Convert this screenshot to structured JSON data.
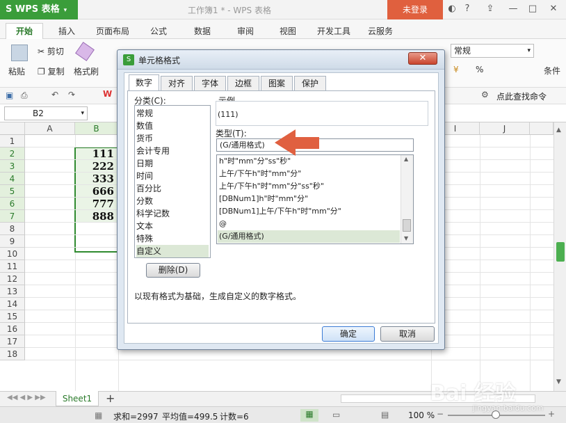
{
  "titlebar": {
    "app_name": "WPS 表格",
    "doc_title": "工作簿1 * - WPS 表格",
    "login": "未登录"
  },
  "ribbon_tabs": [
    "开始",
    "插入",
    "页面布局",
    "公式",
    "数据",
    "审阅",
    "视图",
    "开发工具",
    "云服务"
  ],
  "ribbon": {
    "paste": "粘贴",
    "cut": "剪切",
    "copy": "复制",
    "format_painter": "格式刷",
    "number_format": "常规",
    "percent": "%",
    "conditions": "条件",
    "find_command": "点此查找命令"
  },
  "formula_bar": {
    "cell_ref": "B2"
  },
  "grid": {
    "columns": [
      "A",
      "B",
      "I",
      "J"
    ],
    "rows": [
      "1",
      "2",
      "3",
      "4",
      "5",
      "6",
      "7",
      "8",
      "9",
      "10",
      "11",
      "12",
      "13",
      "14",
      "15",
      "16",
      "17",
      "18"
    ],
    "b_values": [
      "111",
      "222",
      "333",
      "666",
      "777",
      "888"
    ]
  },
  "sheet_tab": "Sheet1",
  "status": {
    "sum": "求和=2997",
    "avg": "平均值=499.5",
    "count": "计数=6",
    "zoom": "100 %"
  },
  "dialog": {
    "title": "单元格格式",
    "tabs": [
      "数字",
      "对齐",
      "字体",
      "边框",
      "图案",
      "保护"
    ],
    "category_label": "分类(C):",
    "categories": [
      "常规",
      "数值",
      "货币",
      "会计专用",
      "日期",
      "时间",
      "百分比",
      "分数",
      "科学记数",
      "文本",
      "特殊",
      "自定义"
    ],
    "sample_label": "示例",
    "sample_value": "(111)",
    "type_label": "类型(T):",
    "type_value": "(G/通用格式)",
    "format_list": [
      "h\"时\"mm\"分\"ss\"秒\"",
      "上午/下午h\"时\"mm\"分\"",
      "上午/下午h\"时\"mm\"分\"ss\"秒\"",
      "[DBNum1]h\"时\"mm\"分\"",
      "[DBNum1]上午/下午h\"时\"mm\"分\"",
      "@",
      "(G/通用格式)"
    ],
    "delete_button": "删除(D)",
    "description": "以现有格式为基础，生成自定义的数字格式。",
    "ok_button": "确定",
    "cancel_button": "取消"
  },
  "watermark": {
    "main": "Bai 经验",
    "sub": "jingyan.baidu.com"
  },
  "colors": {
    "accent_green": "#3a9d3a",
    "login_orange": "#e0603e",
    "arrow": "#e06040",
    "selection": "#eaf4e6"
  }
}
